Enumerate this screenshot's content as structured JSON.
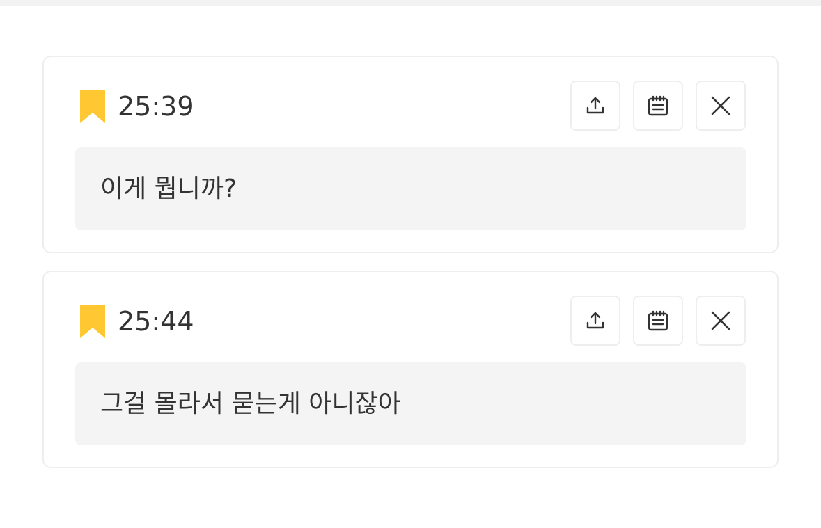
{
  "colors": {
    "bookmark": "#FFC832",
    "card_border": "#EEEEEE",
    "text_box_bg": "#F4F4F4",
    "text": "#333333"
  },
  "icons": {
    "bookmark": "bookmark-icon",
    "share": "share-upload-icon",
    "note": "notepad-icon",
    "close": "close-icon"
  },
  "bookmarks": [
    {
      "time": "25:39",
      "text": "이게 뭡니까?"
    },
    {
      "time": "25:44",
      "text": "그걸 몰라서 묻는게 아니잖아"
    }
  ]
}
